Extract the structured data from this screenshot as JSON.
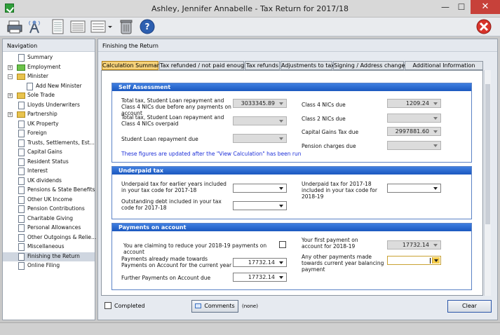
{
  "window": {
    "title": "Ashley, Jennifer Annabelle - Tax Return for 2017/18",
    "minimize": "—",
    "maximize": "☐",
    "close": "✕"
  },
  "toolbar": {
    "icons": [
      "print-icon",
      "network-icon",
      "form-icon",
      "form-list-icon",
      "list-dropdown-icon",
      "trash-icon",
      "help-icon",
      "exit-icon"
    ]
  },
  "nav": {
    "heading": "Navigation",
    "items": [
      {
        "label": "Summary",
        "icon": "doc",
        "indent": 0
      },
      {
        "label": "Employment",
        "icon": "folder-check",
        "indent": 0,
        "expander": "+"
      },
      {
        "label": "Minister",
        "icon": "folder",
        "indent": 0,
        "expander": "−"
      },
      {
        "label": "Add New Minister",
        "icon": "doc",
        "indent": 1
      },
      {
        "label": "Sole Trade",
        "icon": "folder",
        "indent": 0,
        "expander": "+"
      },
      {
        "label": "Lloyds Underwriters",
        "icon": "doc",
        "indent": 0
      },
      {
        "label": "Partnership",
        "icon": "folder",
        "indent": 0,
        "expander": "+"
      },
      {
        "label": "UK Property",
        "icon": "doc",
        "indent": 0
      },
      {
        "label": "Foreign",
        "icon": "doc",
        "indent": 0
      },
      {
        "label": "Trusts, Settlements, Est...",
        "icon": "doc",
        "indent": 0
      },
      {
        "label": "Capital Gains",
        "icon": "doc",
        "indent": 0
      },
      {
        "label": "Resident Status",
        "icon": "doc",
        "indent": 0
      },
      {
        "label": "Interest",
        "icon": "doc",
        "indent": 0
      },
      {
        "label": "UK dividends",
        "icon": "doc",
        "indent": 0
      },
      {
        "label": "Pensions & State Benefits",
        "icon": "doc",
        "indent": 0
      },
      {
        "label": "Other UK Income",
        "icon": "doc",
        "indent": 0
      },
      {
        "label": "Pension Contributions",
        "icon": "doc",
        "indent": 0
      },
      {
        "label": "Charitable Giving",
        "icon": "doc",
        "indent": 0
      },
      {
        "label": "Personal Allowances",
        "icon": "doc",
        "indent": 0
      },
      {
        "label": "Other Outgoings & Relie...",
        "icon": "doc",
        "indent": 0
      },
      {
        "label": "Miscellaneous",
        "icon": "doc",
        "indent": 0
      },
      {
        "label": "Finishing the Return",
        "icon": "doc",
        "indent": 0,
        "selected": true
      },
      {
        "label": "Online Filing",
        "icon": "doc",
        "indent": 0
      }
    ]
  },
  "main": {
    "heading": "Finishing the Return",
    "tabs": [
      "Calculation Summary",
      "Tax refunded / not paid enough",
      "Tax refunds",
      "Adjustments to tax",
      "Signing / Address changed",
      "Additional Information"
    ],
    "self_assessment": {
      "title": "Self Assessment",
      "total_due_label": "Total tax, Student Loan repayment and Class 4 NICs due before any payments on account",
      "total_due_value": "3033345.89",
      "total_overpaid_label": "Total tax, Student Loan repayment and Class 4 NICs overpaid",
      "total_overpaid_value": "",
      "student_loan_label": "Student Loan repayment due",
      "student_loan_value": "",
      "note": "These figures are updated after the \"View Calculation\" has been run",
      "class4_label": "Class 4 NICs due",
      "class4_value": "1209.24",
      "class2_label": "Class 2 NICs due",
      "class2_value": "",
      "cgt_label": "Capital Gains Tax due",
      "cgt_value": "2997881.60",
      "pension_label": "Pension charges due",
      "pension_value": ""
    },
    "underpaid": {
      "title": "Underpaid tax",
      "earlier_label": "Underpaid tax for earlier years included in your tax code for 2017-18",
      "earlier_value": "",
      "outstanding_label": "Outstanding debt included in your tax code for 2017-18",
      "outstanding_value": "",
      "next_year_label": "Underpaid tax for 2017-18 included in your tax code for 2018-19",
      "next_year_value": ""
    },
    "payments": {
      "title": "Payments on account",
      "claim_label": "You are claiming to reduce your 2018-19 payments on account",
      "already_label": "Payments already made towards Payments on Account for the current year",
      "already_value": "17732.14",
      "further_label": "Further Payments on Account due",
      "further_value": "17732.14",
      "first_label": "Your first payment on account for 2018-19",
      "first_value": "17732.14",
      "other_label": "Any other payments made towards current year balancing payment",
      "other_value": ""
    },
    "completed_label": "Completed",
    "comments_button": "Comments",
    "comments_status": "(none)",
    "clear_button": "Clear"
  }
}
